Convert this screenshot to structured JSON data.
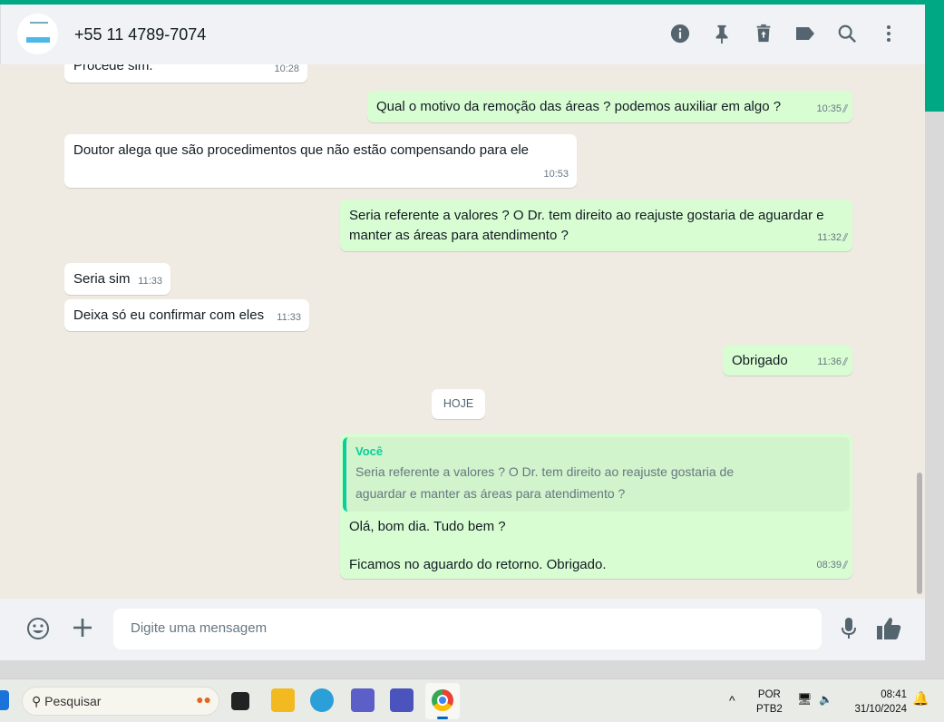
{
  "header": {
    "contact": "+55 11 4789-7074",
    "icons": [
      "info-icon",
      "pin-icon",
      "delete-icon",
      "label-icon",
      "search-icon",
      "menu-icon"
    ]
  },
  "messages": [
    {
      "dir": "in",
      "text": "Procede sim.",
      "time": "10:28"
    },
    {
      "dir": "out",
      "text": "Qual o motivo da remoção das áreas ? podemos auxiliar em algo ?",
      "time": "10:35"
    },
    {
      "dir": "in",
      "text": "Doutor alega que são procedimentos que não estão compensando para ele",
      "time": "10:53"
    },
    {
      "dir": "out",
      "text": "Seria referente a valores ? O Dr. tem direito ao reajuste gostaria de aguardar e manter as áreas para atendimento ?",
      "time": "11:32"
    },
    {
      "dir": "in",
      "text": "Seria sim",
      "time": "11:33"
    },
    {
      "dir": "in",
      "text": "Deixa só eu confirmar com eles",
      "time": "11:33"
    },
    {
      "dir": "out",
      "text": "Obrigado",
      "time": "11:36"
    },
    {
      "dir": "out",
      "quote_author": "Você",
      "quote_text": "Seria referente a valores ? O Dr. tem direito ao reajuste gostaria de aguardar e manter as áreas para atendimento ?",
      "line1": "Olá, bom dia. Tudo bem ?",
      "line2": "Ficamos no aguardo do retorno. Obrigado.",
      "time": "08:39"
    }
  ],
  "date_divider": "HOJE",
  "footer": {
    "placeholder": "Digite uma mensagem"
  },
  "taskbar": {
    "search": "Pesquisar",
    "lang1": "POR",
    "lang2": "PTB2",
    "time": "08:41",
    "date": "31/10/2024"
  },
  "colors": {
    "accent": "#00a884",
    "outgoing": "#d9fdd3",
    "incoming": "#ffffff"
  }
}
